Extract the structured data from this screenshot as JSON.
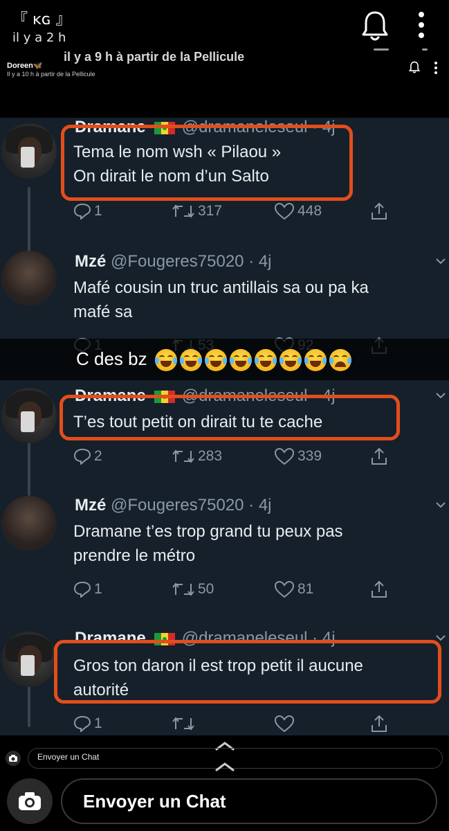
{
  "snap_header": {
    "sender": "『 ĸɢ 』",
    "time": "il y a 2 h",
    "ghost_caption": "il y a 9 h à partir de la Pellicule",
    "inner_sender": "Doreen🦋",
    "inner_time": "Il y a 10 h à partir de la Pellicule",
    "bell_icon": "bell-icon",
    "menu_icon": "vertical-dots-icon"
  },
  "tweets": [
    {
      "name": "Dramane",
      "handle": "@dramaneleseul · 4j",
      "text_lines": [
        "Tema le nom wsh « Pilaou »",
        "On dirait le nom d’un Salto"
      ],
      "replies": "1",
      "retweets": "317",
      "likes": "448",
      "highlighted": true
    },
    {
      "name": "Mzé",
      "handle": "@Fougeres75020 · 4j",
      "text_lines": [
        "Mafé cousin un truc antillais sa ou pa ka",
        "mafé sa"
      ],
      "replies": "1",
      "retweets": "53",
      "likes": "92",
      "highlighted": false
    },
    {
      "name": "Dramane",
      "handle": "@dramaneleseul · 4j",
      "text_lines": [
        "T’es tout petit on dirait tu te cache"
      ],
      "replies": "2",
      "retweets": "283",
      "likes": "339",
      "highlighted": true
    },
    {
      "name": "Mzé",
      "handle": "@Fougeres75020 · 4j",
      "text_lines": [
        "Dramane t’es trop grand tu peux pas",
        "prendre le métro"
      ],
      "replies": "1",
      "retweets": "50",
      "likes": "81",
      "highlighted": false
    },
    {
      "name": "Dramane",
      "handle": "@dramaneleseul · 4j",
      "text_lines": [
        "Gros ton daron il est trop petit il aucune",
        "autorité"
      ],
      "replies": "1",
      "retweets": "",
      "likes": "",
      "highlighted": true
    }
  ],
  "caption": {
    "text": "C des bz",
    "emojis": [
      "laughing-tears-emoji",
      "laughing-tears-emoji",
      "laughing-tears-emoji",
      "laughing-tears-emoji",
      "laughing-tears-emoji",
      "laughing-tears-emoji",
      "laughing-tears-emoji",
      "sobbing-emoji"
    ]
  },
  "chat": {
    "mini_placeholder": "Envoyer un Chat",
    "placeholder": "Envoyer un Chat",
    "camera_icon": "camera-icon",
    "chevron_icon": "chevron-up-icon"
  },
  "colors": {
    "tweet_bg": "#15202b",
    "highlight": "#e24e1b",
    "muted": "#8899a6",
    "senegal_flag": [
      "#1a9a3b",
      "#f2d32a",
      "#d62a2a"
    ]
  }
}
